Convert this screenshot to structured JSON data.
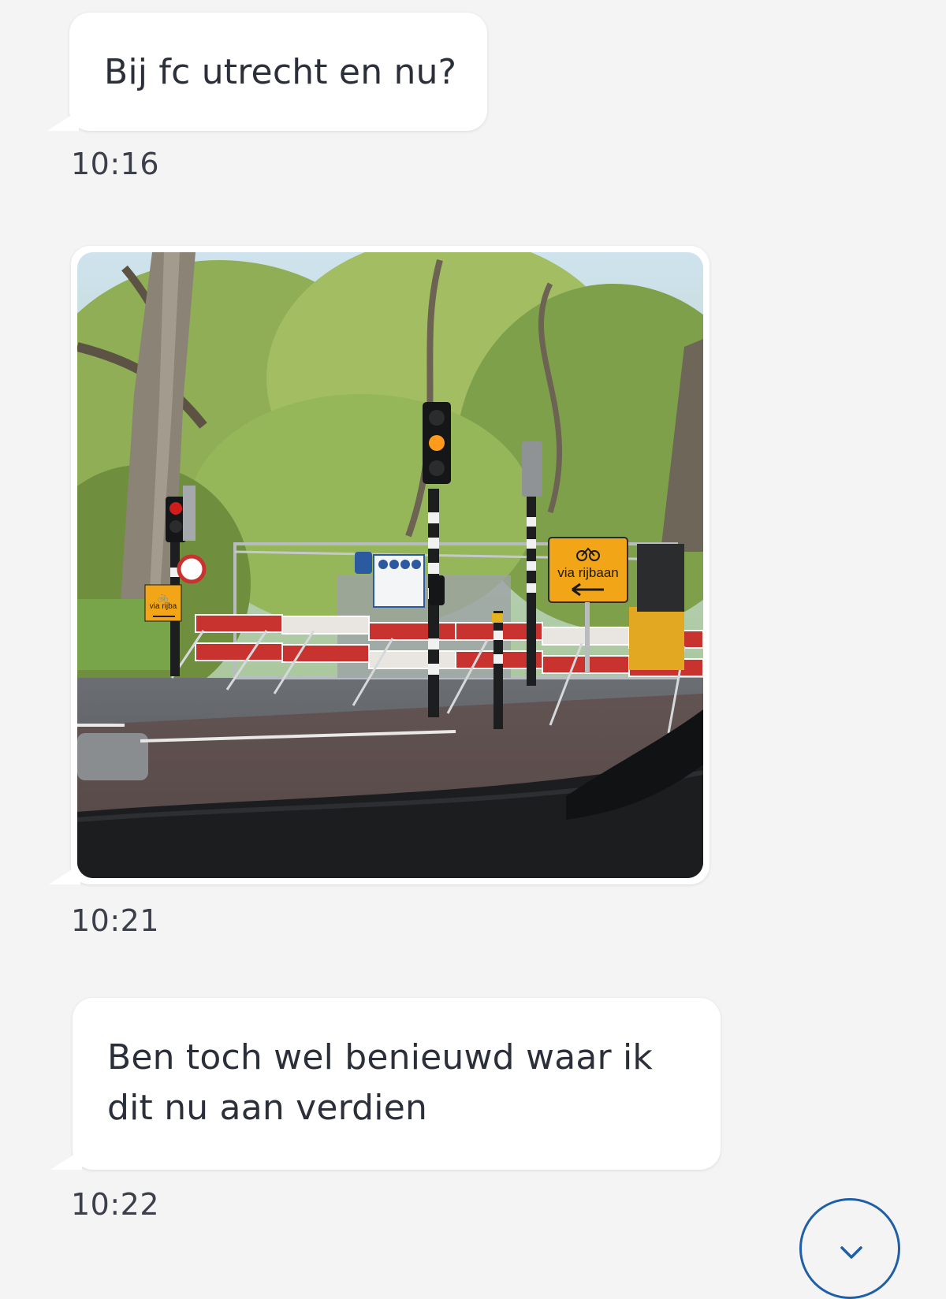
{
  "messages": [
    {
      "text": "Bij fc utrecht en nu?",
      "time": "10:16"
    },
    {
      "type": "image",
      "time": "10:21",
      "image_signs": {
        "sign_large": "via rijbaan",
        "sign_small": "via rijba"
      }
    },
    {
      "text_line1": "Ben toch wel benieuwd waar ik",
      "text_line2": "dit nu aan verdien",
      "time": "10:22"
    }
  ],
  "scroll_button": {
    "icon": "chevron-down-icon",
    "color": "#1f5fa8"
  }
}
